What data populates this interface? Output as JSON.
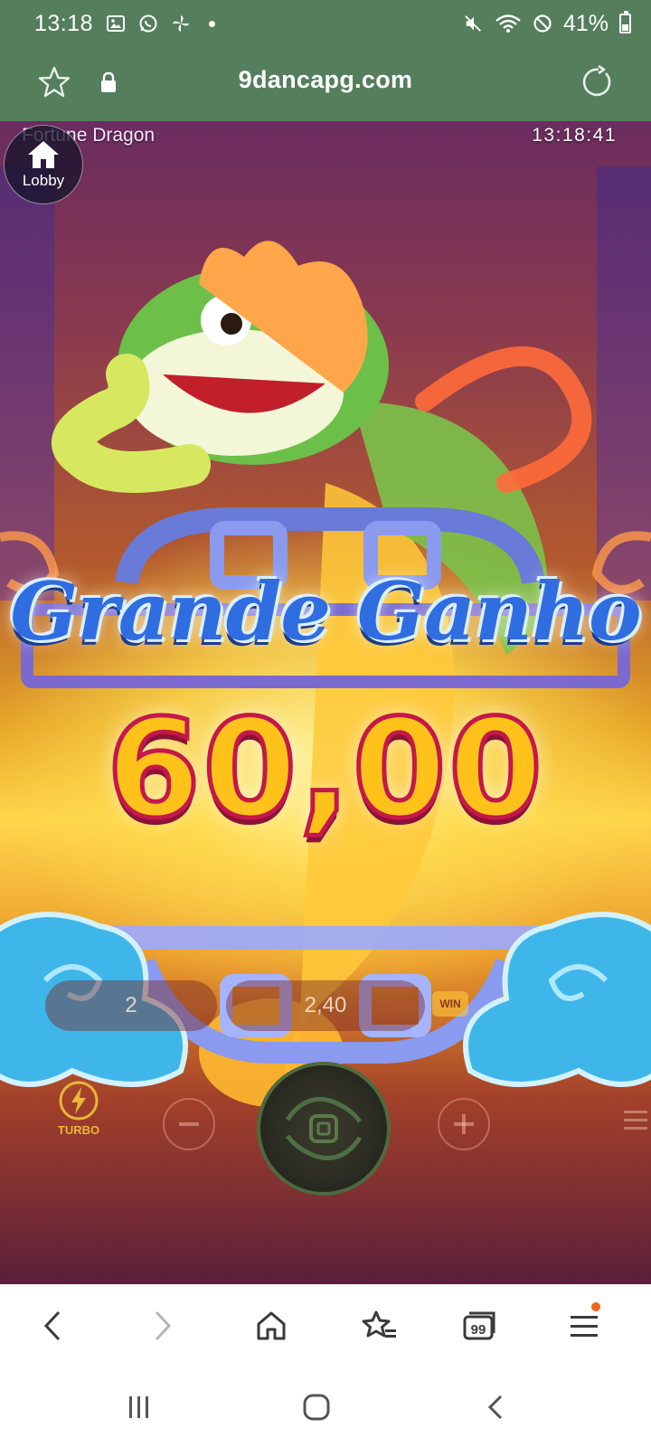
{
  "status_bar": {
    "time": "13:18",
    "battery": "41%",
    "icons": [
      "gallery-icon",
      "whatsapp-icon",
      "pinwheel-icon",
      "dot-icon",
      "mute-icon",
      "wifi-icon",
      "dnd-icon",
      "battery-icon"
    ]
  },
  "url_bar": {
    "url": "9dancapg.com",
    "icons": [
      "star-icon",
      "lock-icon",
      "reload-icon"
    ]
  },
  "game": {
    "title": "Fortune Dragon",
    "clock": "13:18:41",
    "lobby_label": "Lobby",
    "banner": "Grande Ganho",
    "win_amount": "60,00",
    "bet_value": "2",
    "balance_value": "2,40",
    "win_badge": "WIN",
    "turbo_label": "TURBO",
    "colors": {
      "banner_blue": "#2f6de0",
      "amount_gold": "#ffc21a",
      "amount_stroke": "#c4184a"
    }
  },
  "browser_toolbar": {
    "buttons": [
      "back-icon",
      "forward-icon",
      "home-icon",
      "bookmarks-icon",
      "tabs-icon",
      "menu-icon"
    ],
    "tabs_count": "99",
    "notification_color": "#f06418"
  },
  "nav_bar": {
    "buttons": [
      "recents-icon",
      "home-icon",
      "back-icon"
    ]
  }
}
